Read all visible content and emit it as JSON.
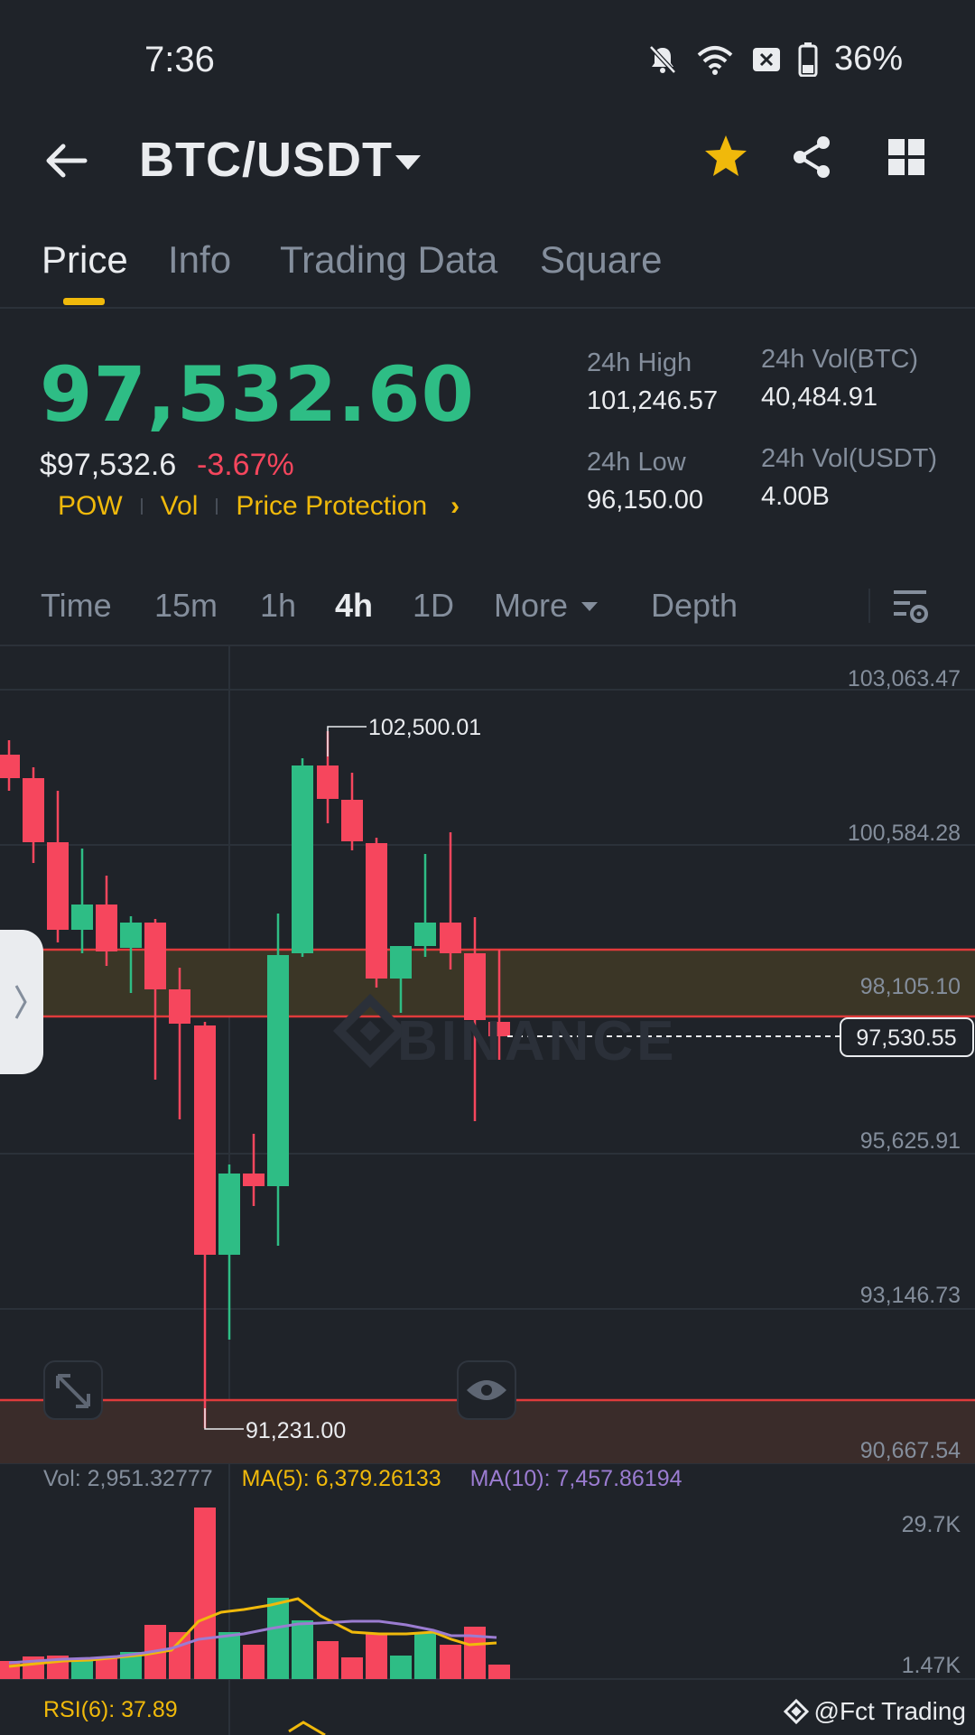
{
  "status_bar": {
    "time": "7:36",
    "battery": "36%"
  },
  "header": {
    "pair": "BTC/USDT"
  },
  "tabs": [
    {
      "label": "Price",
      "active": true
    },
    {
      "label": "Info",
      "active": false
    },
    {
      "label": "Trading Data",
      "active": false
    },
    {
      "label": "Square",
      "active": false
    }
  ],
  "ticker": {
    "last_price": "97,532.60",
    "usd_price": "$97,532.6",
    "change": "-3.67%",
    "tags": [
      "POW",
      "Vol",
      "Price Protection"
    ],
    "high_label": "24h High",
    "high_value": "101,246.57",
    "low_label": "24h Low",
    "low_value": "96,150.00",
    "vol_btc_label": "24h Vol(BTC)",
    "vol_btc_value": "40,484.91",
    "vol_usdt_label": "24h Vol(USDT)",
    "vol_usdt_value": "4.00B"
  },
  "intervals": [
    {
      "label": "Time",
      "active": false
    },
    {
      "label": "15m",
      "active": false
    },
    {
      "label": "1h",
      "active": false
    },
    {
      "label": "4h",
      "active": true
    },
    {
      "label": "1D",
      "active": false
    },
    {
      "label": "More",
      "active": false
    },
    {
      "label": "Depth",
      "active": false
    }
  ],
  "chart": {
    "watermark": "BINANCE",
    "price_ticks": [
      "103,063.47",
      "100,584.28",
      "98,105.10",
      "95,625.91",
      "93,146.73",
      "90,667.54"
    ],
    "current_price_label": "97,530.55",
    "high_marker": "102,500.01",
    "low_marker": "91,231.00",
    "vol_legend": {
      "vol": "Vol: 2,951.32777",
      "ma5": "MA(5): 6,379.26133",
      "ma10": "MA(10): 7,457.86194"
    },
    "vol_ticks": [
      "29.7K",
      "1.47K"
    ],
    "rsi_legend": "RSI(6): 37.89",
    "brand": "@Fct Trading",
    "colors": {
      "up": "#2ebd85",
      "down": "#f6465d",
      "ma5": "#f0b90b",
      "ma10": "#9b7cd1",
      "zone": "#f0b90b"
    }
  }
}
